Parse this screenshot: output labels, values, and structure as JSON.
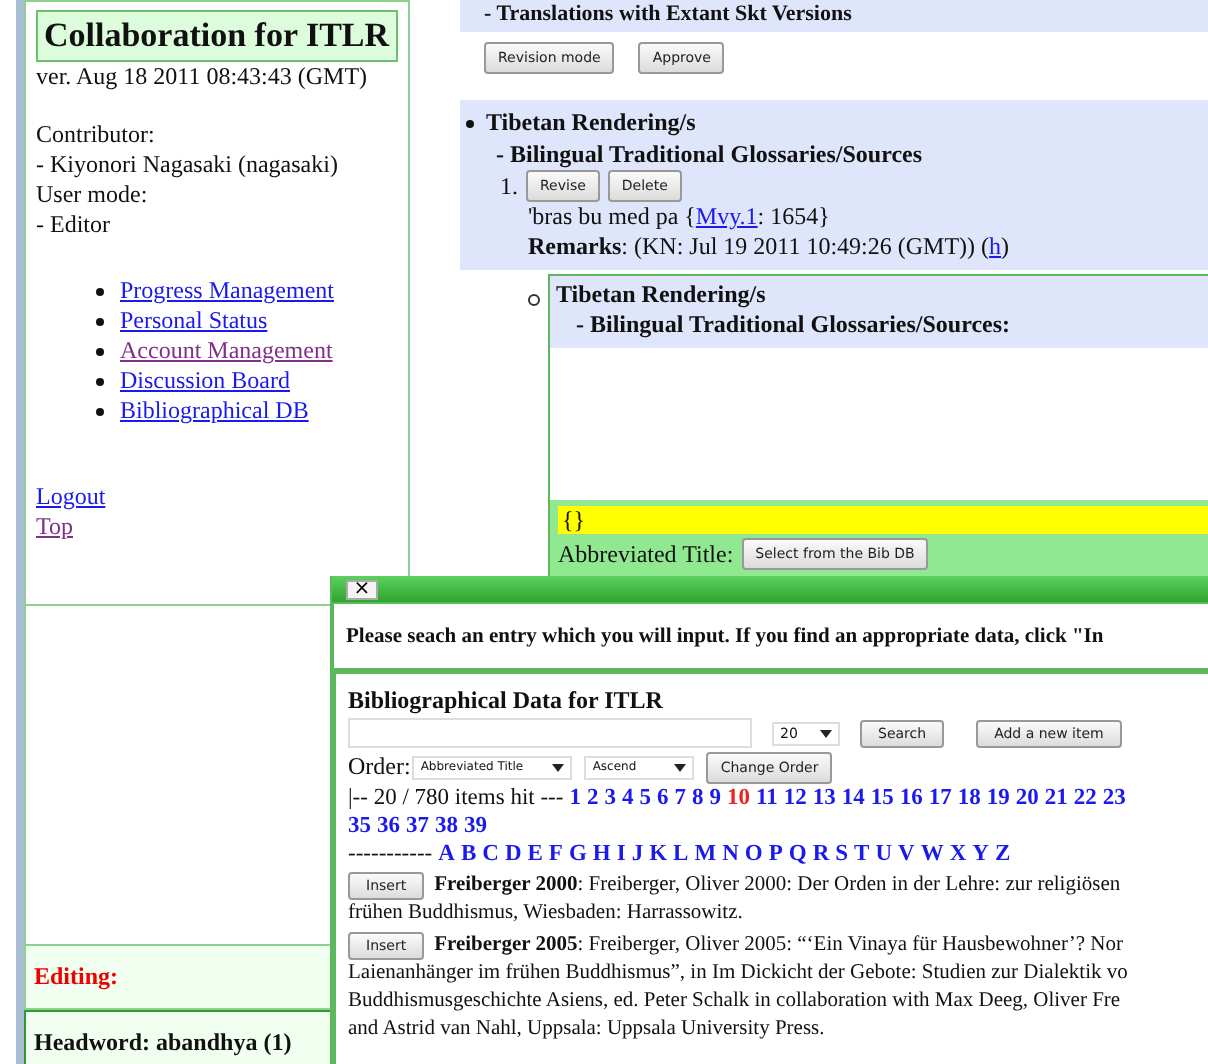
{
  "sidebar": {
    "title": "Collaboration for ITLR",
    "version": "ver. Aug 18 2011 08:43:43 (GMT)",
    "info_lines": [
      "Contributor:",
      "- Kiyonori Nagasaki (nagasaki)",
      "User mode:",
      "- Editor"
    ],
    "menu": [
      {
        "label": "Progress Management",
        "visited": false
      },
      {
        "label": "Personal Status",
        "visited": false
      },
      {
        "label": "Account Management",
        "visited": true
      },
      {
        "label": "Discussion Board",
        "visited": false
      },
      {
        "label": "Bibliographical DB",
        "visited": false
      }
    ],
    "links": [
      {
        "label": "Logout",
        "visited": false
      },
      {
        "label": "Top",
        "visited": true
      }
    ],
    "editing_label": "Editing:",
    "headword": "Headword: abandhya (1)"
  },
  "main": {
    "section_heading": "- Translations with Extant Skt Versions",
    "buttons": [
      "Revision mode",
      "Approve"
    ],
    "entry": {
      "heading": "Tibetan Rendering/s",
      "subheading": "- Bilingual Traditional Glossaries/Sources",
      "number": "1.",
      "buttons": [
        "Revise",
        "Delete"
      ],
      "text_before": "'bras bu med pa {",
      "link": "Mvy.1",
      "text_after": ": 1654}",
      "remarks_label": "Remarks",
      "remarks": ": (KN: Jul 19 2011 10:49:26 (GMT)) (",
      "remarks_link": "h",
      "remarks_end": ")"
    },
    "editor": {
      "heading": "Tibetan Rendering/s",
      "subheading": "- Bilingual Traditional Glossaries/Sources:",
      "preview": "{}",
      "field_label": "Abbreviated Title:",
      "select_button": "Select from the Bib DB"
    }
  },
  "dialog": {
    "close": "×",
    "instruction": "Please seach an entry which you will input. If you find an appropriate data, click \"In",
    "title": "Bibliographical Data for ITLR",
    "per_page": "20",
    "search_button": "Search",
    "add_button": "Add a new item",
    "order_label": "Order:",
    "order_field": "Abbreviated Title",
    "order_direction": "Ascend",
    "order_button": "Change Order",
    "hit_text": "|-- 20 / 780 items hit ---",
    "pages": [
      {
        "label": "1",
        "selected": false
      },
      {
        "label": "2",
        "selected": false
      },
      {
        "label": "3",
        "selected": false
      },
      {
        "label": "4",
        "selected": false
      },
      {
        "label": "5",
        "selected": false
      },
      {
        "label": "6",
        "selected": false
      },
      {
        "label": "7",
        "selected": false
      },
      {
        "label": "8",
        "selected": false
      },
      {
        "label": "9",
        "selected": false
      },
      {
        "label": "10",
        "selected": true
      },
      {
        "label": "11",
        "selected": false
      },
      {
        "label": "12",
        "selected": false
      },
      {
        "label": "13",
        "selected": false
      },
      {
        "label": "14",
        "selected": false
      },
      {
        "label": "15",
        "selected": false
      },
      {
        "label": "16",
        "selected": false
      },
      {
        "label": "17",
        "selected": false
      },
      {
        "label": "18",
        "selected": false
      },
      {
        "label": "19",
        "selected": false
      },
      {
        "label": "20",
        "selected": false
      },
      {
        "label": "21",
        "selected": false
      },
      {
        "label": "22",
        "selected": false
      },
      {
        "label": "23",
        "selected": false
      }
    ],
    "more_pages": [
      {
        "label": "35",
        "selected": false
      },
      {
        "label": "36",
        "selected": false
      },
      {
        "label": "37",
        "selected": false
      },
      {
        "label": "38",
        "selected": false
      },
      {
        "label": "39",
        "selected": false
      }
    ],
    "letters_prefix": "-----------",
    "letters": [
      "A",
      "B",
      "C",
      "D",
      "E",
      "F",
      "G",
      "H",
      "I",
      "J",
      "K",
      "L",
      "M",
      "N",
      "O",
      "P",
      "Q",
      "R",
      "S",
      "T",
      "U",
      "V",
      "W",
      "X",
      "Y",
      "Z"
    ],
    "entries": [
      {
        "button": "Insert",
        "key": "Freiberger 2000",
        "lines": [
          ": Freiberger, Oliver 2000: Der Orden in der Lehre: zur religiösen",
          "frühen Buddhismus, Wiesbaden: Harrassowitz."
        ]
      },
      {
        "button": "Insert",
        "key": "Freiberger 2005",
        "lines": [
          ": Freiberger, Oliver 2005: “‘Ein Vinaya für Hausbewohner’? Nor",
          "Laienanhänger im frühen Buddhismus”, in Im Dickicht der Gebote: Studien zur Dialektik vo",
          "Buddhismusgeschichte Asiens, ed. Peter Schalk in collaboration with Max Deeg, Oliver Fre",
          "and Astrid van Nahl, Uppsala: Uppsala University Press."
        ]
      }
    ]
  }
}
